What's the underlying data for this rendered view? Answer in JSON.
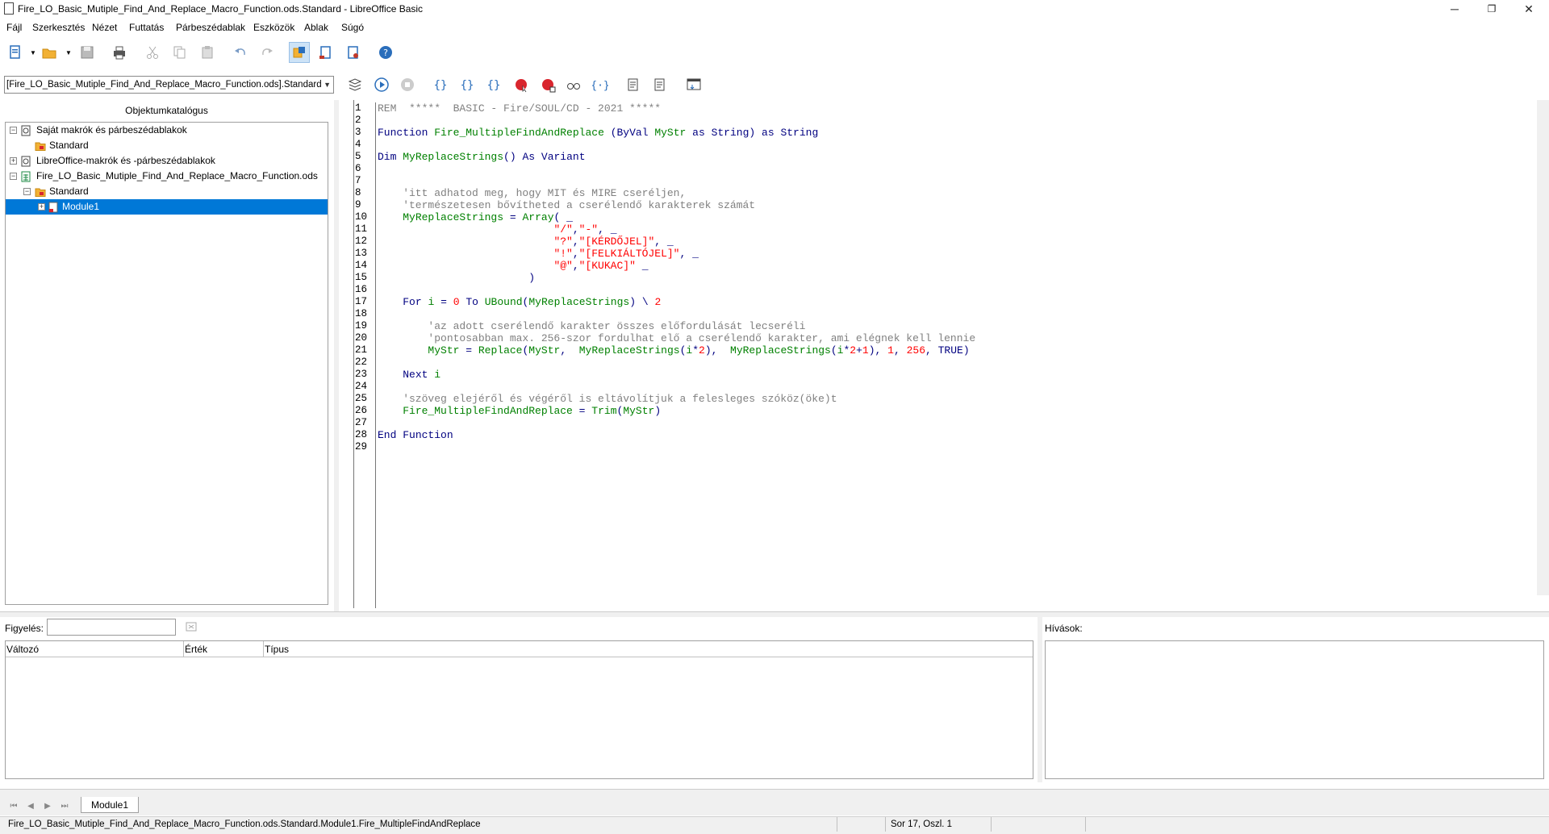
{
  "window": {
    "title": "Fire_LO_Basic_Mutiple_Find_And_Replace_Macro_Function.ods.Standard - LibreOffice Basic",
    "minimize": "─",
    "restore": "❐",
    "close": "✕"
  },
  "menu": [
    "Fájl",
    "Szerkesztés",
    "Nézet",
    "Futtatás",
    "Párbeszédablak",
    "Eszközök",
    "Ablak",
    "Súgó"
  ],
  "library_selector": {
    "value": "[Fire_LO_Basic_Mutiple_Find_And_Replace_Macro_Function.ods].Standard"
  },
  "object_catalog": {
    "title": "Objektumkatalógus",
    "items": [
      {
        "label": "Saját makrók és párbeszédablakok"
      },
      {
        "label": "Standard"
      },
      {
        "label": "LibreOffice-makrók és -párbeszédablakok"
      },
      {
        "label": "Fire_LO_Basic_Mutiple_Find_And_Replace_Macro_Function.ods"
      },
      {
        "label": "Standard"
      },
      {
        "label": "Module1"
      }
    ]
  },
  "editor": {
    "line_numbers": [
      "1",
      "2",
      "3",
      "4",
      "5",
      "6",
      "7",
      "8",
      "9",
      "10",
      "11",
      "12",
      "13",
      "14",
      "15",
      "16",
      "17",
      "18",
      "19",
      "20",
      "21",
      "22",
      "23",
      "24",
      "25",
      "26",
      "27",
      "28",
      "29"
    ]
  },
  "watch": {
    "label": "Figyelés:",
    "input_value": "",
    "columns": [
      "Változó",
      "Érték",
      "Típus"
    ]
  },
  "calls": {
    "label": "Hívások:"
  },
  "tabs": [
    "Module1"
  ],
  "status": {
    "path": "Fire_LO_Basic_Mutiple_Find_And_Replace_Macro_Function.ods.Standard.Module1.Fire_MultipleFindAndReplace",
    "position": "Sor 17, Oszl. 1"
  },
  "colors": {
    "selection": "#0078d7",
    "comment": "#808080",
    "keyword": "#000080",
    "identifier": "#008000",
    "literal": "#ff0000"
  }
}
